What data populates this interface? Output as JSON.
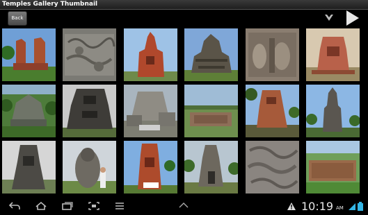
{
  "window": {
    "title": "Temples Gallery Thumbnail"
  },
  "actionbar": {
    "back_label": "Back",
    "menu_icon": "overflow-menu-icon",
    "play_icon": "play-icon"
  },
  "gallery": {
    "thumbnails": [
      {
        "subject": "twin red brick temples"
      },
      {
        "subject": "stone relief panel"
      },
      {
        "subject": "red brick temple tower"
      },
      {
        "subject": "stepped stone temple"
      },
      {
        "subject": "carved stone statues"
      },
      {
        "subject": "brick temple ruin"
      },
      {
        "subject": "temple with green roof"
      },
      {
        "subject": "dark stone temple"
      },
      {
        "subject": "temple ruins complex"
      },
      {
        "subject": "ruins in field"
      },
      {
        "subject": "brick temple with trees"
      },
      {
        "subject": "tall stone tower"
      },
      {
        "subject": "carved stone shrine"
      },
      {
        "subject": "guardian statue"
      },
      {
        "subject": "brick gate tower"
      },
      {
        "subject": "temple gate with trees"
      },
      {
        "subject": "relief carving"
      },
      {
        "subject": "stone wall with grass"
      }
    ]
  },
  "statusbar": {
    "time": "10:19",
    "ampm": "AM"
  },
  "colors": {
    "accent": "#33b5e5",
    "background": "#000000"
  }
}
